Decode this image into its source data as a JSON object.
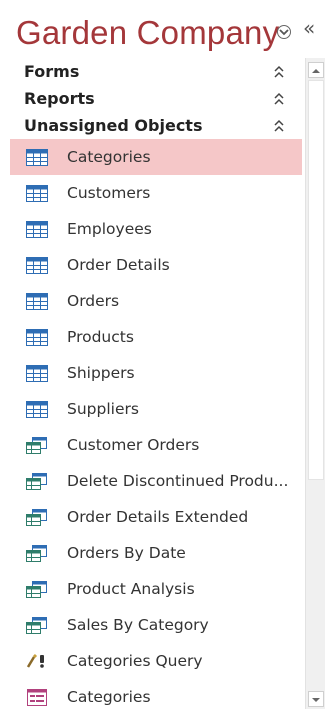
{
  "pane": {
    "title": "Garden Company"
  },
  "groups": [
    {
      "label": "Forms"
    },
    {
      "label": "Reports"
    },
    {
      "label": "Unassigned Objects"
    }
  ],
  "items": [
    {
      "label": "Categories",
      "icon": "table-icon",
      "selected": true
    },
    {
      "label": "Customers",
      "icon": "table-icon"
    },
    {
      "label": "Employees",
      "icon": "table-icon"
    },
    {
      "label": "Order Details",
      "icon": "table-icon"
    },
    {
      "label": "Orders",
      "icon": "table-icon"
    },
    {
      "label": "Products",
      "icon": "table-icon"
    },
    {
      "label": "Shippers",
      "icon": "table-icon"
    },
    {
      "label": "Suppliers",
      "icon": "table-icon"
    },
    {
      "label": "Customer Orders",
      "icon": "select-query-icon"
    },
    {
      "label": "Delete Discontinued Produ...",
      "icon": "select-query-icon"
    },
    {
      "label": "Order Details Extended",
      "icon": "select-query-icon"
    },
    {
      "label": "Orders By Date",
      "icon": "select-query-icon"
    },
    {
      "label": "Product Analysis",
      "icon": "select-query-icon"
    },
    {
      "label": "Sales By Category",
      "icon": "select-query-icon"
    },
    {
      "label": "Categories Query",
      "icon": "action-query-icon"
    },
    {
      "label": "Categories",
      "icon": "form-icon"
    }
  ],
  "colors": {
    "title": "#a4373a",
    "selected_background": "#f5c7c8",
    "table_icon": "#2e6db4",
    "query_icon": "#2f7d6b"
  }
}
